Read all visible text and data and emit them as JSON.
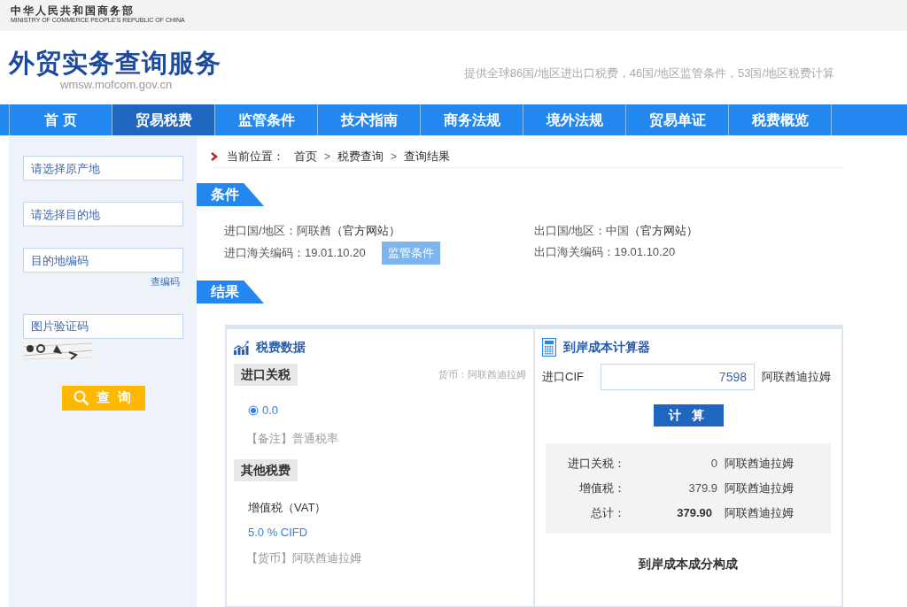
{
  "ministry": {
    "name": "中华人民共和国商务部",
    "english": "MINISTRY OF COMMERCE PEOPLE'S REPUBLIC OF CHINA"
  },
  "site": {
    "title": "外贸实务查询服务",
    "domain": "wmsw.mofcom.gov.cn",
    "tagline": "提供全球86国/地区进出口税费，46国/地区监管条件，53国/地区税费计算"
  },
  "nav": [
    {
      "label": "首 页",
      "selected": false
    },
    {
      "label": "贸易税费",
      "selected": true
    },
    {
      "label": "监管条件",
      "selected": false
    },
    {
      "label": "技术指南",
      "selected": false
    },
    {
      "label": "商务法规",
      "selected": false
    },
    {
      "label": "境外法规",
      "selected": false
    },
    {
      "label": "贸易单证",
      "selected": false
    },
    {
      "label": "税费概览",
      "selected": false
    }
  ],
  "sidebar": {
    "origin": {
      "placeholder": "请选择原产地"
    },
    "destination": {
      "placeholder": "请选择目的地"
    },
    "code": {
      "placeholder": "目的地编码"
    },
    "code_link": "查编码",
    "captcha": {
      "placeholder": "图片验证码"
    },
    "search_button": "查 询"
  },
  "breadcrumb": [
    {
      "kind": "label",
      "text": "当前位置："
    },
    {
      "kind": "link",
      "text": "首页"
    },
    {
      "kind": "sep",
      "text": ">"
    },
    {
      "kind": "link",
      "text": "税费查询"
    },
    {
      "kind": "sep",
      "text": ">"
    },
    {
      "kind": "link",
      "text": "查询结果"
    }
  ],
  "conditions": {
    "heading": "条件",
    "import_country": {
      "label": "进口国/地区：",
      "value": "阿联酋",
      "link": "（官方网站）"
    },
    "export_country": {
      "label": "出口国/地区：",
      "value": "中国",
      "link": "（官方网站）"
    },
    "import_code": {
      "label": "进口海关编码：",
      "value": "19.01.10.20",
      "button": "监管条件"
    },
    "export_code": {
      "label": "出口海关编码：",
      "value": "19.01.10.20"
    }
  },
  "results": {
    "heading": "结果",
    "tax_data": {
      "title": "税费数据",
      "import_duty": {
        "tag": "进口关税",
        "currency": "货币：阿联酋迪拉姆",
        "rates": [
          {
            "value": "0.0",
            "selected": true
          }
        ],
        "note": "【备注】普通税率"
      },
      "other": {
        "tag": "其他税费",
        "name": "增值税（VAT）",
        "rate": "5.0 % CIFD",
        "currency": "【货币】阿联酋迪拉姆"
      }
    },
    "calculator": {
      "title": "到岸成本计算器",
      "cif_label": "进口CIF",
      "cif_value": "7598",
      "cif_unit": "阿联酋迪拉姆",
      "button": "计 算",
      "rows": [
        {
          "label": "进口关税：",
          "value": "0",
          "unit": "阿联酋迪拉姆",
          "kind": "item"
        },
        {
          "label": "增值税：",
          "value": "379.9",
          "unit": "阿联酋迪拉姆",
          "kind": "item"
        },
        {
          "label": "总计：",
          "value": "379.90",
          "unit": "阿联酋迪拉姆",
          "kind": "total"
        }
      ],
      "breakdown_title": "到岸成本成分构成"
    }
  }
}
